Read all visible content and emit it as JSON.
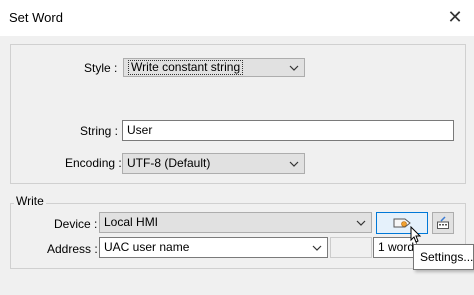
{
  "window": {
    "title": "Set Word",
    "close_icon": "close-icon"
  },
  "form": {
    "style_label": "Style :",
    "style_value": "Write constant string",
    "string_label": "String :",
    "string_value": "User",
    "encoding_label": "Encoding :",
    "encoding_value": "UTF-8 (Default)"
  },
  "write_group": {
    "title": "Write",
    "device_label": "Device :",
    "device_value": "Local HMI",
    "address_label": "Address :",
    "address_value": "UAC user name",
    "word_count": "1 word"
  },
  "tooltip": {
    "text": "Settings..."
  },
  "colors": {
    "selection_border": "#0078d7",
    "selection_fill": "#e5f1fb"
  }
}
